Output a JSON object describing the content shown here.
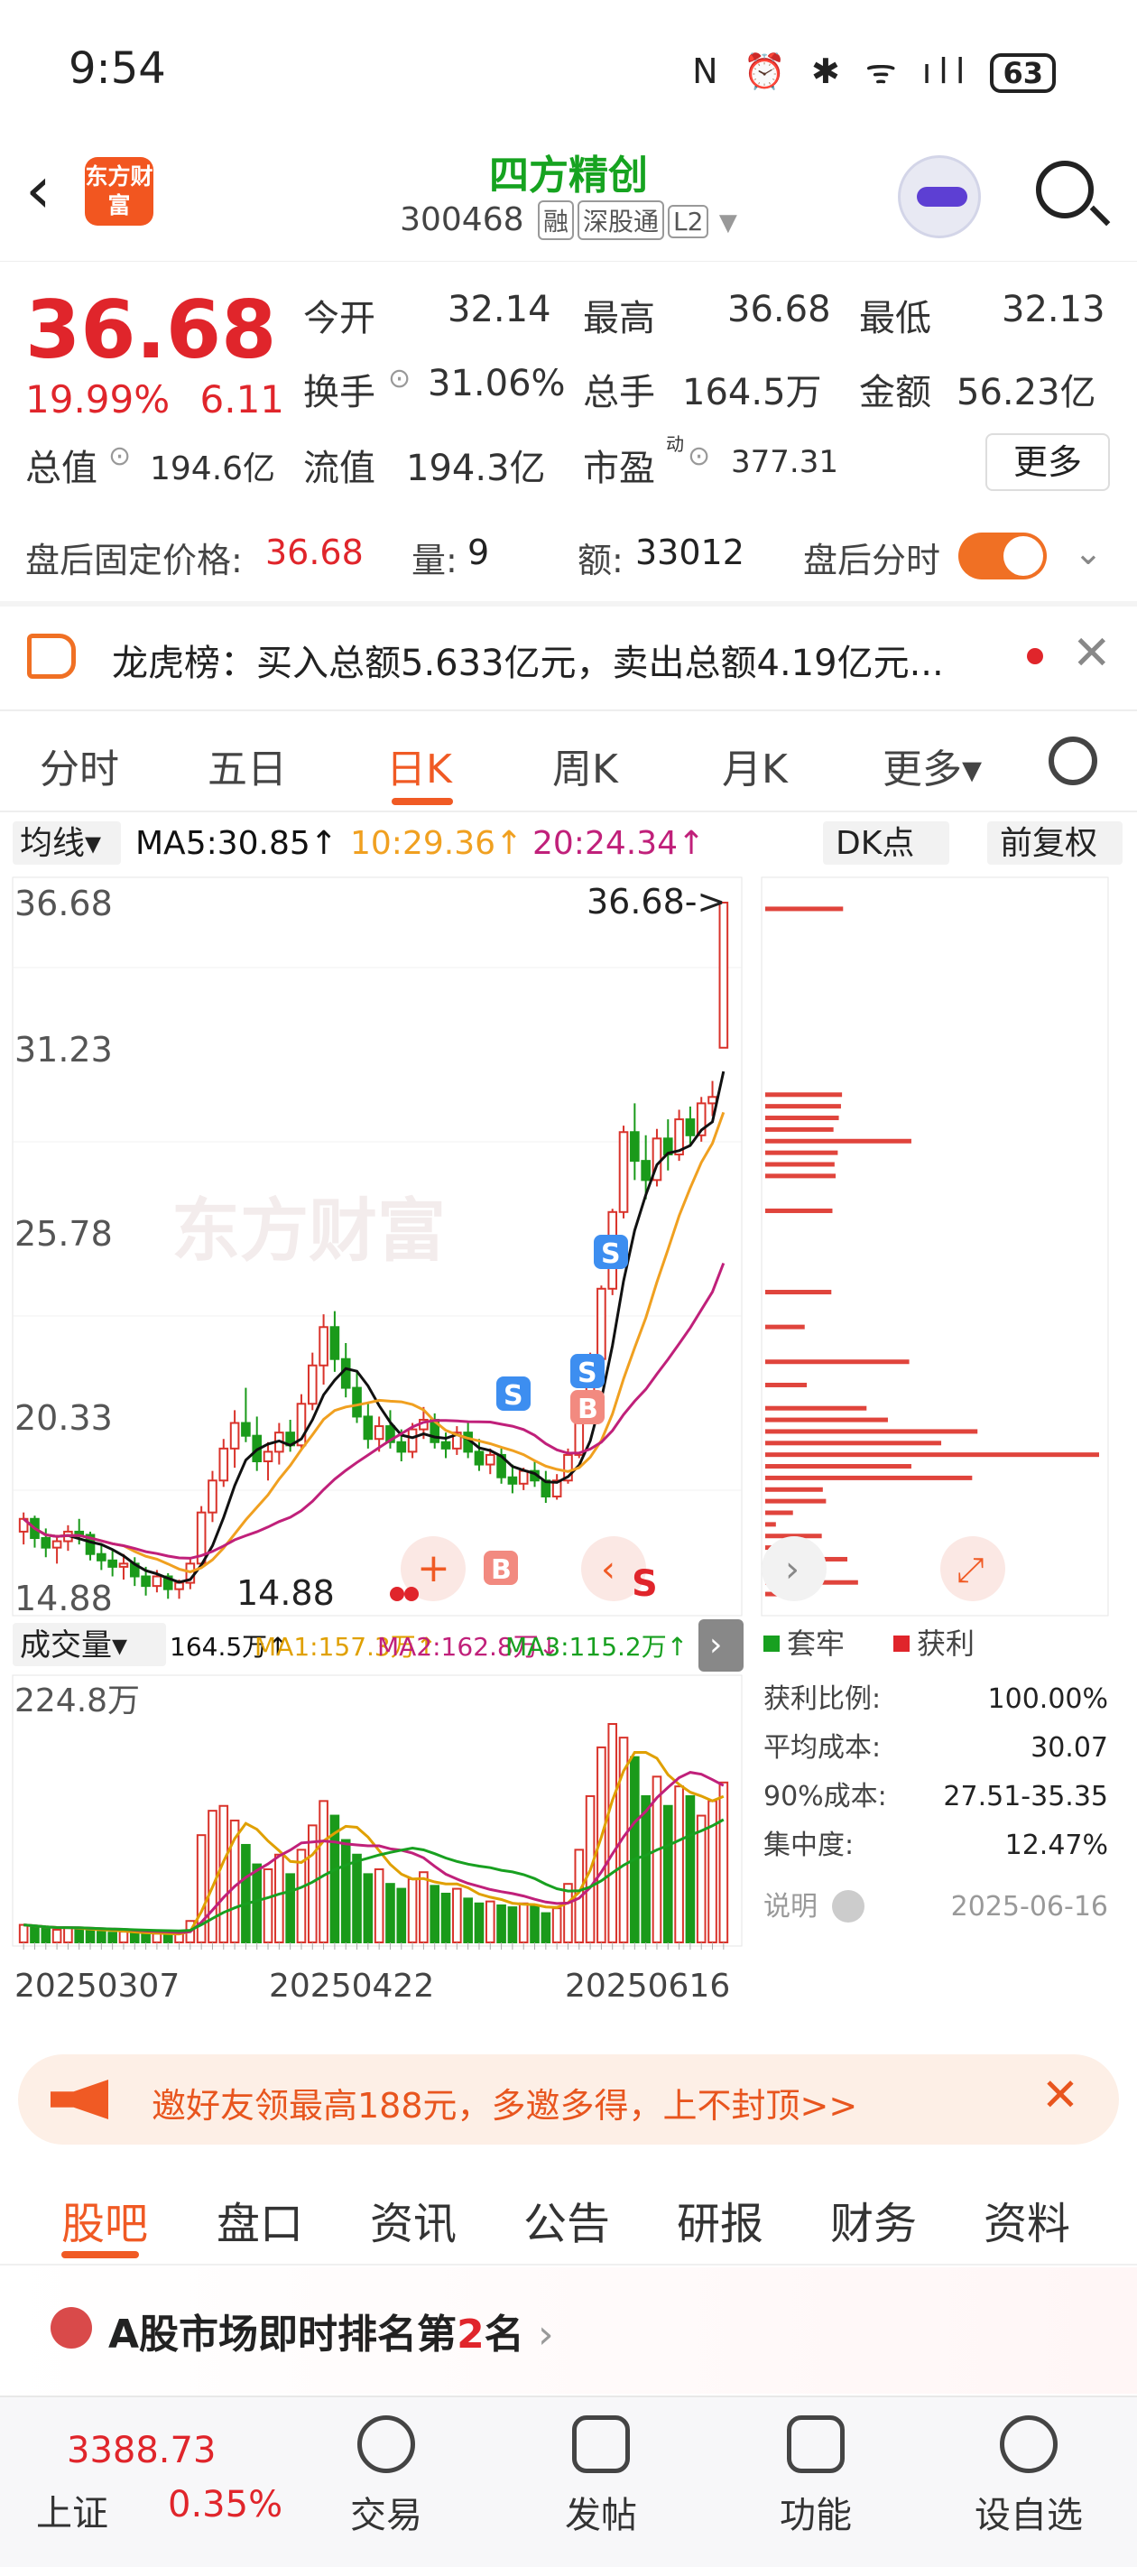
{
  "status": {
    "time": "9:54",
    "icons": "N ⏰ ✱ ᯤ ıll",
    "battery": "63"
  },
  "header": {
    "logo": "东方财富",
    "title": "四方精创",
    "code": "300468",
    "tags": [
      "融",
      "深股通",
      "L2"
    ]
  },
  "quote": {
    "price": "36.68",
    "change_pct": "19.99%",
    "change_abs": "6.11",
    "open_label": "今开",
    "open": "32.14",
    "high_label": "最高",
    "high": "36.68",
    "low_label": "最低",
    "low": "32.13",
    "turnover_label": "换手",
    "turnover": "31.06%",
    "volume_label": "总手",
    "volume": "164.5万",
    "amount_label": "金额",
    "amount": "56.23亿",
    "mktcap_label": "总值",
    "mktcap": "194.6亿",
    "float_label": "流值",
    "float": "194.3亿",
    "pe_label": "市盈",
    "pe_sup": "动",
    "pe": "377.31",
    "more_label": "更多"
  },
  "after_hours": {
    "price_label": "盘后固定价格:",
    "price": "36.68",
    "vol_label": "量:",
    "vol": "9",
    "amt_label": "额:",
    "amt": "33012",
    "timeshare_label": "盘后分时"
  },
  "dragon_tiger": {
    "text": "龙虎榜：买入总额5.633亿元，卖出总额4.19亿元..."
  },
  "kline_tabs": [
    "分时",
    "五日",
    "日K",
    "周K",
    "月K",
    "更多▾"
  ],
  "kline_active": "日K",
  "indicators": {
    "ma_select": "均线▾",
    "ma5": "MA5:30.85↑",
    "ma10": "10:29.36↑",
    "ma20": "20:24.34↑",
    "dk": "DK点",
    "adjust": "前复权",
    "ma5_color": "#111111",
    "ma10_color": "#f0a020",
    "ma20_color": "#c0207a"
  },
  "price_axis": {
    "ticks": [
      "36.68",
      "31.23",
      "25.78",
      "20.33",
      "14.88"
    ],
    "last_label": "36.68->",
    "low_label": "14.88"
  },
  "chart_data": {
    "type": "candlestick",
    "price_range": [
      14.88,
      36.68
    ],
    "x_ticks": [
      "20250307",
      "20250422",
      "20250616"
    ],
    "candles": [
      [
        17.0,
        17.6,
        16.6,
        17.4
      ],
      [
        17.4,
        17.5,
        16.5,
        16.8
      ],
      [
        16.8,
        17.1,
        16.2,
        16.5
      ],
      [
        16.5,
        16.9,
        16.0,
        16.7
      ],
      [
        16.7,
        17.2,
        16.4,
        17.0
      ],
      [
        17.0,
        17.4,
        16.6,
        16.9
      ],
      [
        16.9,
        17.0,
        16.1,
        16.3
      ],
      [
        16.3,
        16.6,
        15.8,
        16.1
      ],
      [
        16.1,
        16.4,
        15.6,
        15.9
      ],
      [
        15.9,
        16.3,
        15.5,
        16.0
      ],
      [
        16.0,
        16.2,
        15.3,
        15.6
      ],
      [
        15.6,
        15.9,
        15.0,
        15.3
      ],
      [
        15.3,
        15.8,
        15.1,
        15.6
      ],
      [
        15.6,
        15.7,
        14.9,
        15.2
      ],
      [
        15.2,
        15.5,
        14.9,
        15.4
      ],
      [
        15.4,
        16.2,
        15.2,
        16.0
      ],
      [
        16.0,
        17.8,
        15.9,
        17.6
      ],
      [
        17.6,
        18.9,
        17.3,
        18.6
      ],
      [
        18.6,
        19.9,
        18.4,
        19.6
      ],
      [
        19.6,
        20.8,
        19.0,
        20.4
      ],
      [
        20.4,
        21.5,
        19.8,
        20.0
      ],
      [
        20.0,
        20.6,
        18.9,
        19.2
      ],
      [
        19.2,
        19.8,
        18.6,
        19.5
      ],
      [
        19.5,
        20.4,
        19.1,
        20.1
      ],
      [
        20.1,
        20.5,
        19.5,
        19.7
      ],
      [
        19.7,
        21.3,
        19.6,
        21.0
      ],
      [
        21.0,
        22.6,
        20.8,
        22.2
      ],
      [
        22.2,
        23.8,
        21.6,
        23.4
      ],
      [
        23.4,
        23.9,
        22.0,
        22.4
      ],
      [
        22.4,
        22.9,
        21.2,
        21.5
      ],
      [
        21.5,
        22.0,
        20.4,
        20.6
      ],
      [
        20.6,
        21.0,
        19.6,
        19.9
      ],
      [
        19.9,
        20.6,
        19.5,
        20.3
      ],
      [
        20.3,
        20.8,
        19.6,
        19.8
      ],
      [
        19.8,
        20.2,
        19.2,
        19.5
      ],
      [
        19.5,
        20.4,
        19.3,
        20.2
      ],
      [
        20.2,
        20.9,
        19.9,
        20.5
      ],
      [
        20.5,
        20.7,
        19.6,
        19.8
      ],
      [
        19.8,
        20.1,
        19.3,
        19.6
      ],
      [
        19.6,
        20.3,
        19.4,
        20.1
      ],
      [
        20.1,
        20.4,
        19.3,
        19.5
      ],
      [
        19.5,
        19.9,
        18.9,
        19.1
      ],
      [
        19.1,
        19.6,
        18.8,
        19.4
      ],
      [
        19.4,
        19.6,
        18.5,
        18.7
      ],
      [
        18.7,
        19.1,
        18.2,
        18.5
      ],
      [
        18.5,
        19.0,
        18.3,
        18.9
      ],
      [
        18.9,
        19.2,
        18.4,
        18.6
      ],
      [
        18.6,
        18.9,
        17.9,
        18.1
      ],
      [
        18.1,
        18.8,
        18.0,
        18.6
      ],
      [
        18.6,
        19.6,
        18.5,
        19.4
      ],
      [
        19.4,
        20.9,
        19.3,
        20.7
      ],
      [
        20.7,
        22.6,
        20.4,
        22.4
      ],
      [
        22.4,
        24.7,
        22.2,
        24.6
      ],
      [
        24.6,
        27.1,
        24.4,
        27.0
      ],
      [
        27.0,
        29.7,
        26.8,
        29.5
      ],
      [
        29.5,
        30.4,
        28.0,
        28.6
      ],
      [
        28.6,
        29.4,
        27.4,
        28.0
      ],
      [
        28.0,
        29.6,
        27.8,
        29.3
      ],
      [
        29.3,
        29.9,
        28.3,
        28.8
      ],
      [
        28.8,
        30.2,
        28.6,
        29.9
      ],
      [
        29.9,
        30.3,
        29.1,
        29.4
      ],
      [
        29.4,
        30.6,
        29.2,
        30.4
      ],
      [
        30.4,
        31.1,
        30.0,
        30.6
      ],
      [
        32.14,
        36.68,
        32.13,
        36.68
      ]
    ],
    "volume_max": "224.8万",
    "volume_legend": {
      "select": "成交量▾",
      "vol": "164.5万↑",
      "ma1": "MA1:157.3万↑",
      "ma2": "MA2:162.8万↓",
      "ma3": "MA3:115.2万↑"
    },
    "volumes": [
      18,
      16,
      14,
      13,
      15,
      14,
      12,
      11,
      10,
      11,
      9,
      8,
      9,
      8,
      9,
      22,
      110,
      135,
      140,
      125,
      100,
      80,
      75,
      90,
      70,
      95,
      120,
      145,
      130,
      105,
      90,
      70,
      75,
      60,
      55,
      65,
      72,
      58,
      50,
      55,
      45,
      40,
      42,
      38,
      36,
      40,
      38,
      30,
      35,
      60,
      95,
      150,
      200,
      224,
      210,
      190,
      150,
      170,
      140,
      160,
      150,
      130,
      145,
      164
    ],
    "chips": {
      "suitao": "套牢",
      "huoli": "获利",
      "profit_ratio_label": "获利比例:",
      "profit_ratio": "100.00%",
      "avg_cost_label": "平均成本:",
      "avg_cost": "30.07",
      "cost90_label": "90%成本:",
      "cost90": "27.51-35.35",
      "conc_label": "集中度:",
      "conc": "12.47%",
      "note": "说明",
      "date": "2025-06-16"
    }
  },
  "watermark": "东方财富",
  "banner": {
    "text": "邀好友领最高188元，多邀多得，上不封顶>>"
  },
  "bottom_tabs": [
    "股吧",
    "盘口",
    "资讯",
    "公告",
    "研报",
    "财务",
    "资料"
  ],
  "rank": {
    "text_a": "A股市场即时排名第",
    "num": "2",
    "text_b": "名"
  },
  "bottom_bar": {
    "index_value": "3388.73",
    "index_name": "上证",
    "index_pct": "0.35%",
    "nav": [
      "交易",
      "发帖",
      "功能",
      "设自选"
    ]
  }
}
